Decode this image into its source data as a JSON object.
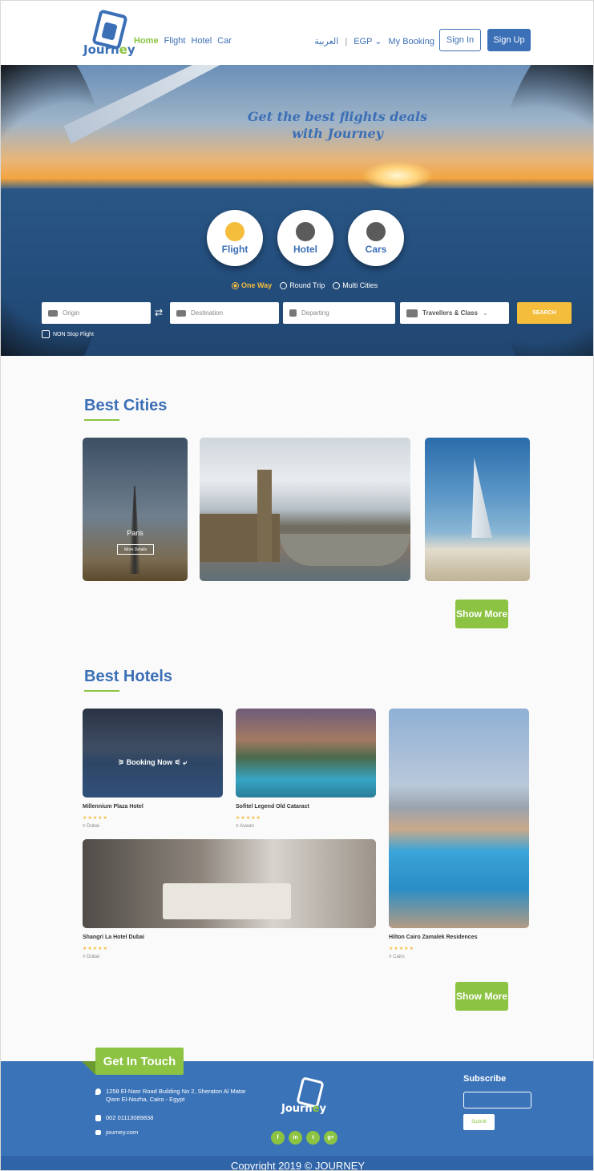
{
  "header": {
    "logo": {
      "text_main": "Journ",
      "text_e": "e",
      "text_end": "y"
    },
    "nav": [
      "Home",
      "Flight",
      "Hotel",
      "Car"
    ],
    "lang": "العربية",
    "currency": "EGP",
    "my_booking": "My Booking",
    "sign_in": "Sign In",
    "sign_up": "Sign Up"
  },
  "hero": {
    "title_line1": "Get the best flights deals",
    "title_line2": "with Journey",
    "tabs": [
      "Flight",
      "Hotel",
      "Cars"
    ],
    "trip_types": [
      "One Way",
      "Round Trip",
      "Multi Cities"
    ],
    "fields": {
      "origin": "Origin",
      "destination": "Destination",
      "departing": "Departing",
      "travellers": "Travellers & Class"
    },
    "search": "SEARCH",
    "non_stop": "NON Stop Flight"
  },
  "best_cities": {
    "title": "Best Cities",
    "paris": {
      "name": "Paris",
      "button": "More Details"
    },
    "show_more": "Show More"
  },
  "best_hotels": {
    "title": "Best Hotels",
    "booking_now": "Booking Now",
    "hotels": [
      {
        "name": "Millennium Plaza Hotel",
        "stars": "★★★★★",
        "location": "Dubai"
      },
      {
        "name": "Sofitel Legend Old Cataract",
        "stars": "★★★★★",
        "location": "Aswan"
      },
      {
        "name": "Shangri La Hotel Dubai",
        "stars": "★★★★★",
        "location": "Dubai"
      },
      {
        "name": "Hilton Cairo Zamalek Residences",
        "stars": "★★★★★",
        "location": "Cairo"
      }
    ],
    "show_more": "Show More"
  },
  "footer": {
    "get_in_touch": "Get In Touch",
    "address_line1": "1258 El-Nasr Road Building No 2, Sheraton Al Matar",
    "address_line2": "Qism El-Nozha, Cairo - Egypt",
    "phone": "002 01113089838",
    "email": "journey.com",
    "logo": {
      "text_main": "Journ",
      "text_e": "e",
      "text_end": "y"
    },
    "social": [
      "f",
      "in",
      "t",
      "g+"
    ],
    "subscribe_title": "Subscribe",
    "submit": "Submit",
    "copyright": "Copyright 2019 © JOURNEY"
  },
  "colors": {
    "brand_blue": "#3b6fb6",
    "accent_green": "#8cc342",
    "accent_yellow": "#f5bd3c"
  }
}
